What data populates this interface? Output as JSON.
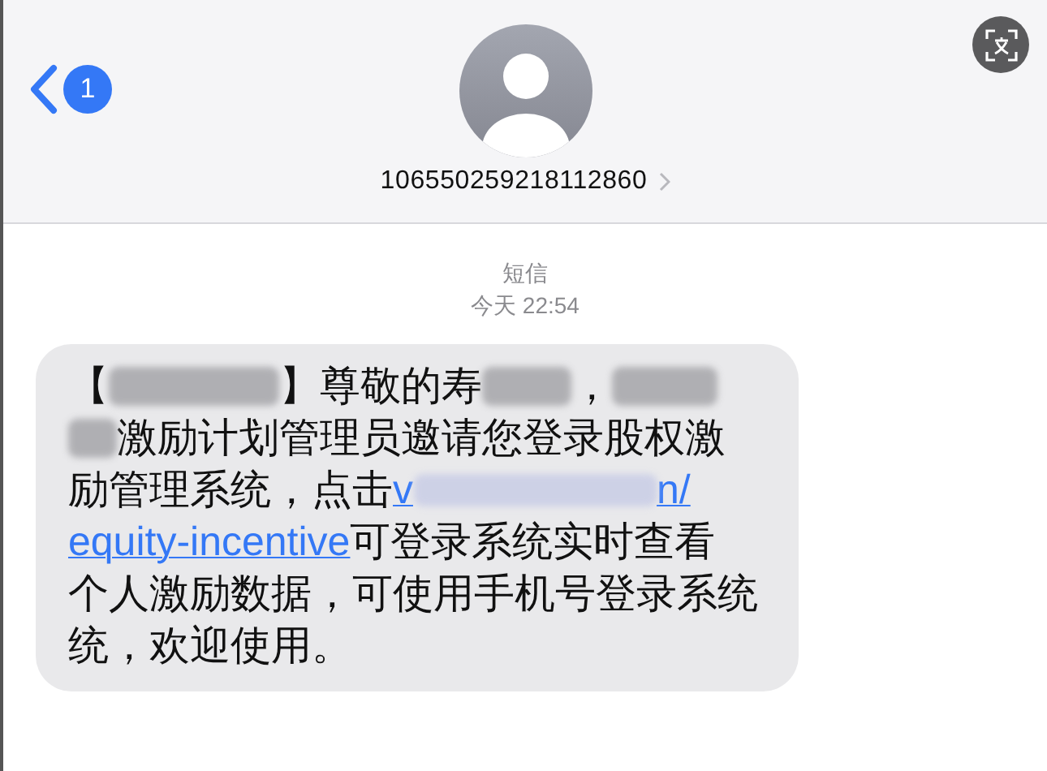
{
  "header": {
    "back_badge": "1",
    "sender": "106550259218112860"
  },
  "thread": {
    "label": "短信",
    "timestamp": "今天 22:54"
  },
  "message": {
    "lines": [
      [
        {
          "kind": "text",
          "text": "【"
        },
        {
          "kind": "redacted"
        },
        {
          "kind": "text",
          "text": "】尊敬的寿"
        },
        {
          "kind": "redacted"
        },
        {
          "kind": "text",
          "text": "，"
        },
        {
          "kind": "redacted"
        }
      ],
      [
        {
          "kind": "redacted"
        },
        {
          "kind": "text",
          "text": "激励计划管理员邀请您登录股权激"
        }
      ],
      [
        {
          "kind": "text",
          "text": "励管理系统，点击 "
        },
        {
          "kind": "link",
          "text": "v"
        },
        {
          "kind": "redacted_link"
        },
        {
          "kind": "link",
          "text": "n/"
        }
      ],
      [
        {
          "kind": "link",
          "text": "equity-incentive"
        },
        {
          "kind": "text",
          "text": " 可登录系统实时查看"
        }
      ],
      [
        {
          "kind": "text",
          "text": "个人激励数据，可使用手机号登录系统"
        }
      ],
      [
        {
          "kind": "text",
          "text": "统，欢迎使用。"
        }
      ]
    ]
  }
}
